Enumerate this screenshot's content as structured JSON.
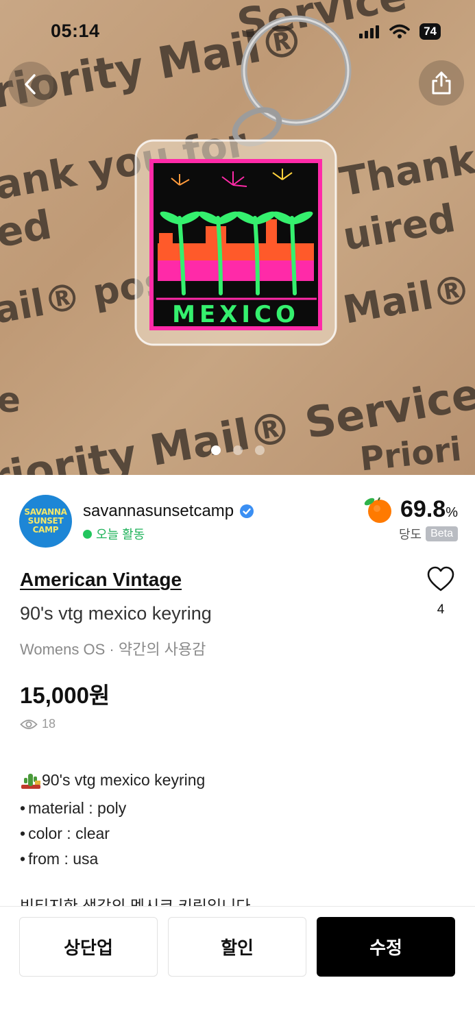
{
  "status_bar": {
    "time": "05:14",
    "battery": "74"
  },
  "hero": {
    "background_text": [
      "riority Mail®",
      "ank you for",
      "ed",
      "ail® pos",
      "e",
      "riority Mail® Service",
      "Service",
      "Thank",
      "uired",
      "Mail®",
      "Priori"
    ],
    "keyring_label": "MEXICO",
    "slide_count": 3,
    "active_slide": 1
  },
  "seller": {
    "avatar_lines": [
      "SAVANNA",
      "SUNSET",
      "CAMP"
    ],
    "name": "savannasunsetcamp",
    "activity": "오늘 활동",
    "score": "69.8",
    "score_unit": "%",
    "score_label": "당도",
    "beta": "Beta"
  },
  "product": {
    "brand": "American Vintage",
    "title": "90's vtg mexico keyring",
    "meta": "Womens OS · 약간의 사용감",
    "price": "15,000원",
    "views": "18",
    "likes": "4"
  },
  "description": {
    "headline": "90's vtg mexico  keyring",
    "bullets": [
      "material : poly",
      "color : clear",
      "from : usa"
    ],
    "cut_line": "빈티지한 색감의 멕시코 키링입니다"
  },
  "actions": {
    "bump": "상단업",
    "discount": "할인",
    "edit": "수정"
  },
  "colors": {
    "accent_green": "#22c55e",
    "avatar_blue": "#1d86d6",
    "primary_button": "#000000",
    "neon_pink": "#ff2aa8",
    "neon_green": "#35f06e"
  }
}
